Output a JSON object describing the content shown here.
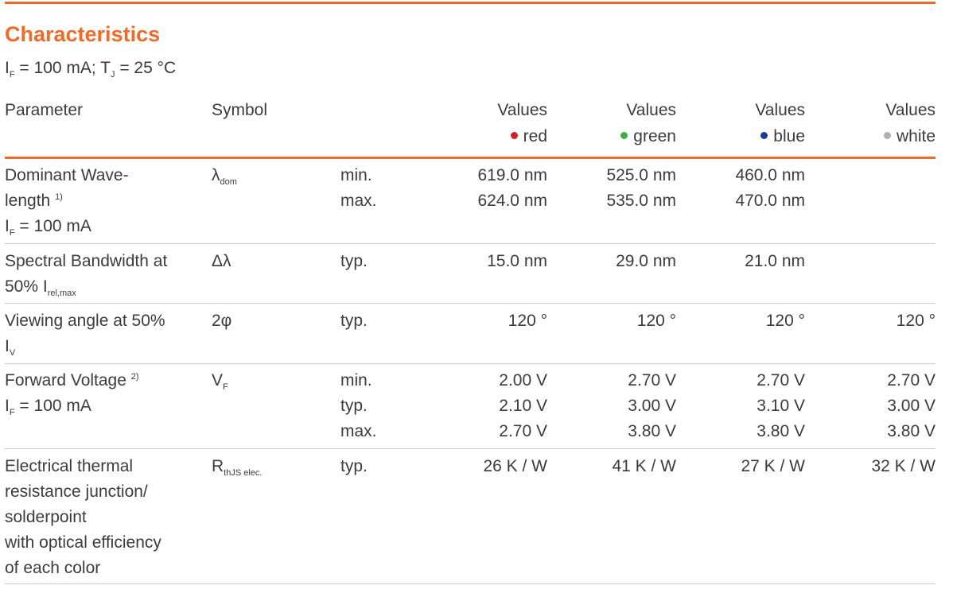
{
  "title": "Characteristics",
  "conditions": {
    "i": "I",
    "i_sub": "F",
    "mid": " = 100 mA; T",
    "t_sub": "J",
    "end": " = 25 °C"
  },
  "header": {
    "parameter": "Parameter",
    "symbol": "Symbol",
    "values_label": "Values",
    "colors": [
      {
        "name": "red",
        "dot": "#d0202a"
      },
      {
        "name": "green",
        "dot": "#3fae49"
      },
      {
        "name": "blue",
        "dot": "#1f3a93"
      },
      {
        "name": "white",
        "dot": "#b0b0b0"
      }
    ]
  },
  "rows": [
    {
      "param_lines": [
        "Dominant Wave-",
        "length",
        "I",
        "F",
        " = 100 mA"
      ],
      "param_sup": "1)",
      "symbol": "λ",
      "symbol_sub": "dom",
      "limits": [
        "min.",
        "max."
      ],
      "red": [
        "619.0 nm",
        "624.0 nm"
      ],
      "green": [
        "525.0 nm",
        "535.0 nm"
      ],
      "blue": [
        "460.0 nm",
        "470.0 nm"
      ],
      "white": [
        "",
        ""
      ]
    },
    {
      "param_lines": [
        "Spectral Bandwidth at",
        "50% I",
        "rel,max"
      ],
      "symbol": "Δλ",
      "symbol_sub": "",
      "limits": [
        "typ."
      ],
      "red": [
        "15.0 nm"
      ],
      "green": [
        "29.0 nm"
      ],
      "blue": [
        "21.0 nm"
      ],
      "white": [
        ""
      ]
    },
    {
      "param_lines": [
        "Viewing angle at 50%",
        "I",
        "V"
      ],
      "symbol": "2φ",
      "symbol_sub": "",
      "limits": [
        "typ."
      ],
      "red": [
        "120 °"
      ],
      "green": [
        "120 °"
      ],
      "blue": [
        "120 °"
      ],
      "white": [
        "120 °"
      ]
    },
    {
      "param_lines": [
        "Forward Voltage",
        "I",
        "F",
        " = 100 mA"
      ],
      "param_sup": "2)",
      "symbol": "V",
      "symbol_sub": "F",
      "limits": [
        "min.",
        "typ.",
        "max."
      ],
      "red": [
        "2.00 V",
        "2.10 V",
        "2.70 V"
      ],
      "green": [
        "2.70 V",
        "3.00 V",
        "3.80 V"
      ],
      "blue": [
        "2.70 V",
        "3.10 V",
        "3.80 V"
      ],
      "white": [
        "2.70 V",
        "3.00 V",
        "3.80 V"
      ]
    },
    {
      "param_lines": [
        "Electrical thermal",
        "resistance junction/",
        "solderpoint",
        "with optical efficiency",
        "of each color"
      ],
      "symbol": "R",
      "symbol_sub": "thJS elec.",
      "limits": [
        "typ."
      ],
      "red": [
        "26 K / W"
      ],
      "green": [
        "41 K / W"
      ],
      "blue": [
        "27 K / W"
      ],
      "white": [
        "32 K / W"
      ]
    }
  ]
}
